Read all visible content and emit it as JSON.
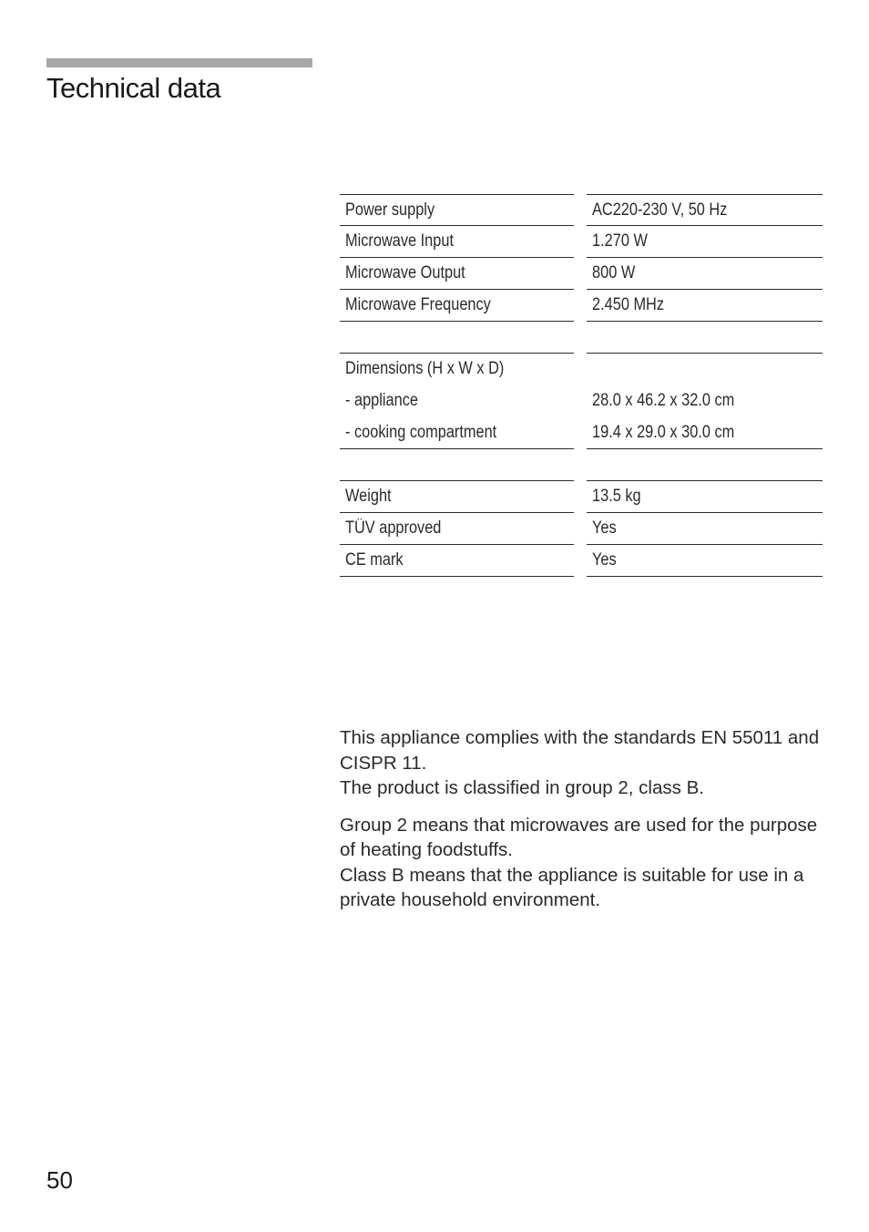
{
  "header": {
    "title": "Technical data"
  },
  "specs": {
    "power_supply": {
      "label": "Power supply",
      "value": "AC220-230 V, 50 Hz"
    },
    "microwave_input": {
      "label": "Microwave Input",
      "value": "1.270 W"
    },
    "microwave_output": {
      "label": "Microwave Output",
      "value": "800 W"
    },
    "microwave_frequency": {
      "label": "Microwave Frequency",
      "value": "2.450 MHz"
    },
    "dimensions": {
      "label": "Dimensions (H x W x D)",
      "appliance": {
        "label": "- appliance",
        "value": "28.0 x 46.2 x 32.0 cm"
      },
      "cooking_compartment": {
        "label": "- cooking compartment",
        "value": "19.4 x 29.0 x 30.0 cm"
      }
    },
    "weight": {
      "label": "Weight",
      "value": "13.5 kg"
    },
    "tuv_approved": {
      "label": "TÜV approved",
      "value": "Yes"
    },
    "ce_mark": {
      "label": "CE mark",
      "value": "Yes"
    }
  },
  "body": {
    "paragraph1_line1": "This appliance complies with the standards EN 55011 and CISPR 11.",
    "paragraph1_line2": "The product is classified in group 2, class B.",
    "paragraph2_line1": "Group 2 means that microwaves are used for the purpose of heating foodstuffs.",
    "paragraph2_line2": "Class B means that the appliance is suitable for use in a private household environment."
  },
  "footer": {
    "page_number": "50"
  }
}
